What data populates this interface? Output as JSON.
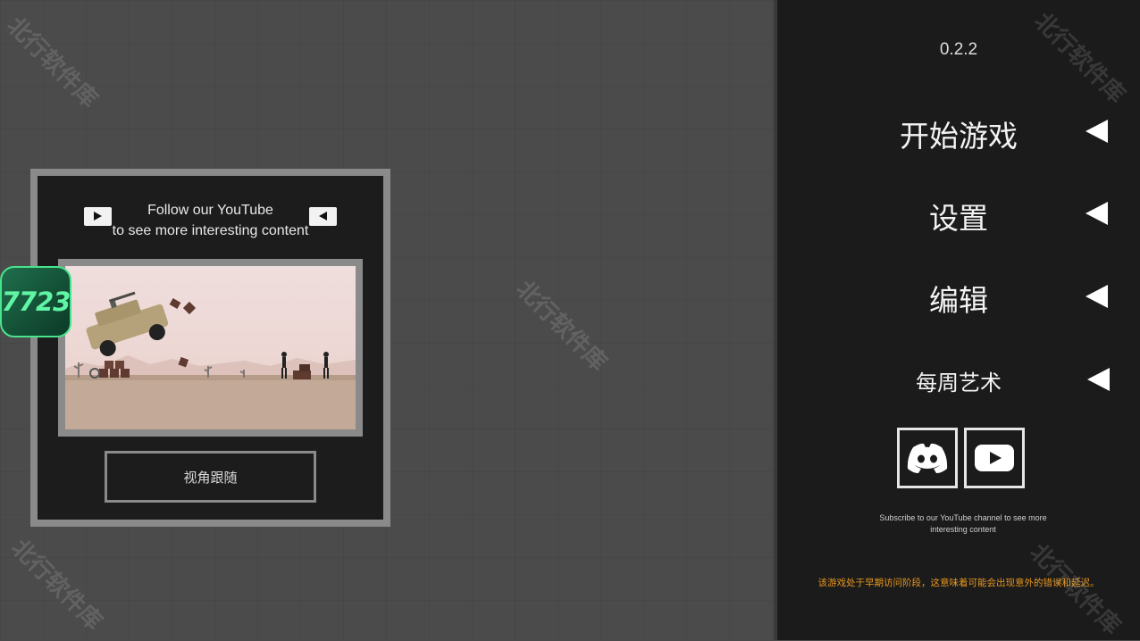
{
  "version": "0.2.2",
  "watermark": "北行软件库",
  "youtube_panel": {
    "line1": "Follow our YouTube",
    "line2": "to see more interesting content",
    "button_label": "视角跟随"
  },
  "badge": "7723",
  "menu": {
    "items": [
      {
        "label": "开始游戏"
      },
      {
        "label": "设置"
      },
      {
        "label": "编辑"
      },
      {
        "label": "每周艺术"
      }
    ]
  },
  "social": {
    "discord_icon": "discord-icon",
    "youtube_icon": "youtube-icon"
  },
  "subscribe_text": "Subscribe to our YouTube channel to see more interesting content",
  "warning_text": "该游戏处于早期访问阶段，这意味着可能会出现意外的错误和延迟。",
  "colors": {
    "sidebar_bg": "#1b1b1b",
    "canvas_bg": "#4b4b4b",
    "warning": "#e8971e",
    "badge_green": "#48e48c"
  }
}
